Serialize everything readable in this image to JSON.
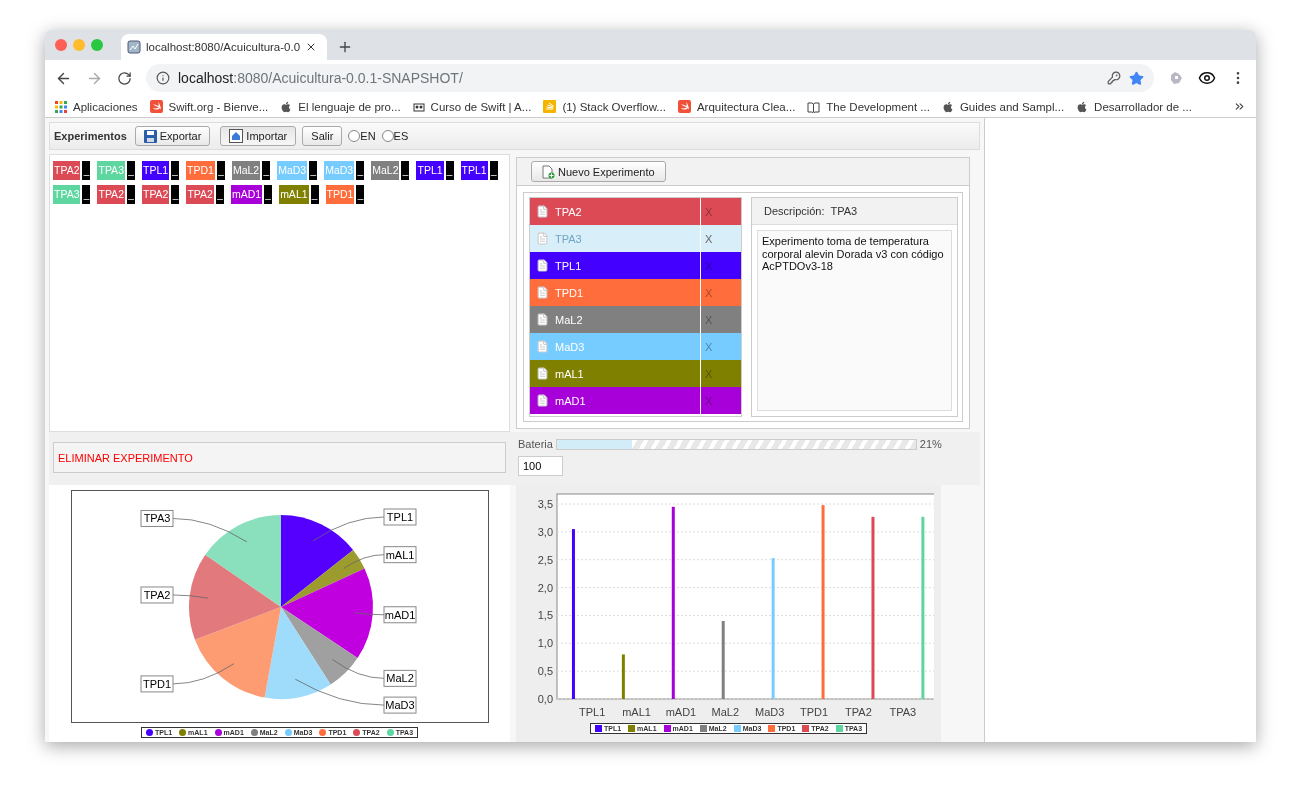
{
  "browser": {
    "tab_title": "localhost:8080/Acuicultura-0.0",
    "url_host": "localhost",
    "url_path": ":8080/Acuicultura-0.0.1-SNAPSHOT/",
    "bookmarks": [
      {
        "kind": "grid",
        "label": "Aplicaciones"
      },
      {
        "kind": "swift",
        "label": "Swift.org - Bienve..."
      },
      {
        "kind": "apple",
        "label": "El lenguaje de pro..."
      },
      {
        "kind": "course",
        "label": "Curso de Swift | A..."
      },
      {
        "kind": "stack",
        "label": "(1) Stack Overflow..."
      },
      {
        "kind": "swift",
        "label": "Arquitectura Clea..."
      },
      {
        "kind": "book",
        "label": "The Development ..."
      },
      {
        "kind": "apple",
        "label": "Guides and Sampl..."
      },
      {
        "kind": "apple",
        "label": "Desarrollador de ..."
      }
    ]
  },
  "toolbar": {
    "title": "Experimentos",
    "buttons": [
      {
        "kind": "save",
        "label": "Exportar"
      },
      {
        "kind": "import",
        "label": "Importar"
      },
      {
        "kind": "plain",
        "label": "Salir"
      }
    ],
    "languages": [
      {
        "label": "EN",
        "selected": false
      },
      {
        "label": "ES",
        "selected": false
      }
    ]
  },
  "tags": [
    {
      "label": "TPA2",
      "color": "#dc4a56",
      "mark": "_"
    },
    {
      "label": "TPA3",
      "color": "#5ed6a0",
      "mark": "_"
    },
    {
      "label": "TPL1",
      "color": "#4400ff",
      "mark": "_"
    },
    {
      "label": "TPD1",
      "color": "#ff6d3c",
      "mark": "_"
    },
    {
      "label": "MaL2",
      "color": "#808080",
      "mark": "_"
    },
    {
      "label": "MaD3",
      "color": "#77ccff",
      "mark": "_"
    },
    {
      "label": "MaD3",
      "color": "#77ccff",
      "mark": "_"
    },
    {
      "label": "MaL2",
      "color": "#808080",
      "mark": "_"
    },
    {
      "label": "TPL1",
      "color": "#4400ff",
      "mark": "_"
    },
    {
      "label": "TPL1",
      "color": "#4400ff",
      "mark": "_"
    },
    {
      "label": "TPA3",
      "color": "#5ed6a0",
      "mark": "_"
    },
    {
      "label": "TPA2",
      "color": "#dc4a56",
      "mark": "_"
    },
    {
      "label": "TPA2",
      "color": "#dc4a56",
      "mark": "_"
    },
    {
      "label": "TPA2",
      "color": "#dc4a56",
      "mark": "_"
    },
    {
      "label": "mAD1",
      "color": "#a800d8",
      "mark": "_"
    },
    {
      "label": "mAL1",
      "color": "#808000",
      "mark": "_"
    },
    {
      "label": "TPD1",
      "color": "#ff6d3c",
      "mark": "_"
    }
  ],
  "new_button": "Nuevo Experimento",
  "experiments": [
    {
      "name": "TPA2",
      "color": "#dc4a56",
      "delete": "X",
      "selected": false
    },
    {
      "name": "TPA3",
      "delete": "X",
      "selected": true
    },
    {
      "name": "TPL1",
      "color": "#4400ff",
      "delete": "X",
      "selected": false
    },
    {
      "name": "TPD1",
      "color": "#ff6d3c",
      "delete": "X",
      "selected": false
    },
    {
      "name": "MaL2",
      "color": "#808080",
      "delete": "X",
      "selected": false
    },
    {
      "name": "MaD3",
      "color": "#77ccff",
      "delete": "X",
      "selected": false
    },
    {
      "name": "mAL1",
      "color": "#808000",
      "delete": "X",
      "selected": false
    },
    {
      "name": "mAD1",
      "color": "#a800d8",
      "delete": "X",
      "selected": false
    }
  ],
  "description": {
    "label": "Descripción:",
    "name": "TPA3",
    "text": "Experimento toma de temperatura corporal alevin Dorada v3 con código AcPTDOv3-18"
  },
  "delete_button": "ELIMINAR EXPERIMENTO",
  "battery": {
    "label": "Bateria",
    "level": 0.21,
    "reading": "21%",
    "input": "100"
  },
  "pie": {
    "chart_data": {
      "type": "pie",
      "categories": [
        "TPL1",
        "mAL1",
        "mAD1",
        "MaL2",
        "MaD3",
        "TPD1",
        "TPA2",
        "TPA3"
      ],
      "values": [
        3.05,
        0.8,
        3.45,
        1.4,
        2.53,
        3.48,
        3.27,
        3.27
      ],
      "colors": [
        "#5500ff",
        "#9b9b2e",
        "#c100e0",
        "#a0a0a0",
        "#9fdcfb",
        "#fd9b73",
        "#e2797d",
        "#8ae0bc"
      ]
    },
    "legend": [
      {
        "label": "TPL1",
        "color": "#4400ff"
      },
      {
        "label": "mAL1",
        "color": "#808000"
      },
      {
        "label": "mAD1",
        "color": "#a800d8"
      },
      {
        "label": "MaL2",
        "color": "#808080"
      },
      {
        "label": "MaD3",
        "color": "#77ccff"
      },
      {
        "label": "TPD1",
        "color": "#ff6d3c"
      },
      {
        "label": "TPA2",
        "color": "#dc4a56"
      },
      {
        "label": "TPA3",
        "color": "#5ed6a0"
      }
    ]
  },
  "bar": {
    "chart_data": {
      "type": "bar",
      "grid": true,
      "categories": [
        "TPL1",
        "mAL1",
        "mAD1",
        "MaL2",
        "MaD3",
        "TPD1",
        "TPA2",
        "TPA3"
      ],
      "ylim": [
        0,
        3.68
      ],
      "yticks": [
        {
          "value": 0,
          "label": "0,0"
        },
        {
          "value": 0.5,
          "label": "0,5"
        },
        {
          "value": 1,
          "label": "1,0"
        },
        {
          "value": 1.5,
          "label": "1,5"
        },
        {
          "value": 2,
          "label": "2,0"
        },
        {
          "value": 2.5,
          "label": "2,5"
        },
        {
          "value": 3,
          "label": "3,0"
        },
        {
          "value": 3.5,
          "label": "3,5"
        }
      ],
      "series": [
        {
          "name": "TPL1",
          "color": "#4400ff",
          "values": [
            3.05,
            null,
            null,
            null,
            null,
            null,
            null,
            null
          ]
        },
        {
          "name": "mAL1",
          "color": "#808000",
          "values": [
            null,
            0.8,
            null,
            null,
            null,
            null,
            null,
            null
          ]
        },
        {
          "name": "mAD1",
          "color": "#a800d8",
          "values": [
            null,
            null,
            3.45,
            null,
            null,
            null,
            null,
            null
          ]
        },
        {
          "name": "MaL2",
          "color": "#808080",
          "values": [
            null,
            null,
            null,
            1.4,
            null,
            null,
            null,
            null
          ]
        },
        {
          "name": "MaD3",
          "color": "#77ccff",
          "values": [
            null,
            null,
            null,
            null,
            2.53,
            null,
            null,
            null
          ]
        },
        {
          "name": "TPD1",
          "color": "#ff6d3c",
          "values": [
            null,
            null,
            null,
            null,
            null,
            3.48,
            null,
            null
          ]
        },
        {
          "name": "TPA2",
          "color": "#dc4a56",
          "values": [
            null,
            null,
            null,
            null,
            null,
            null,
            3.27,
            null
          ]
        },
        {
          "name": "TPA3",
          "color": "#5ed6a0",
          "values": [
            null,
            null,
            null,
            null,
            null,
            null,
            null,
            3.27
          ]
        }
      ]
    }
  }
}
